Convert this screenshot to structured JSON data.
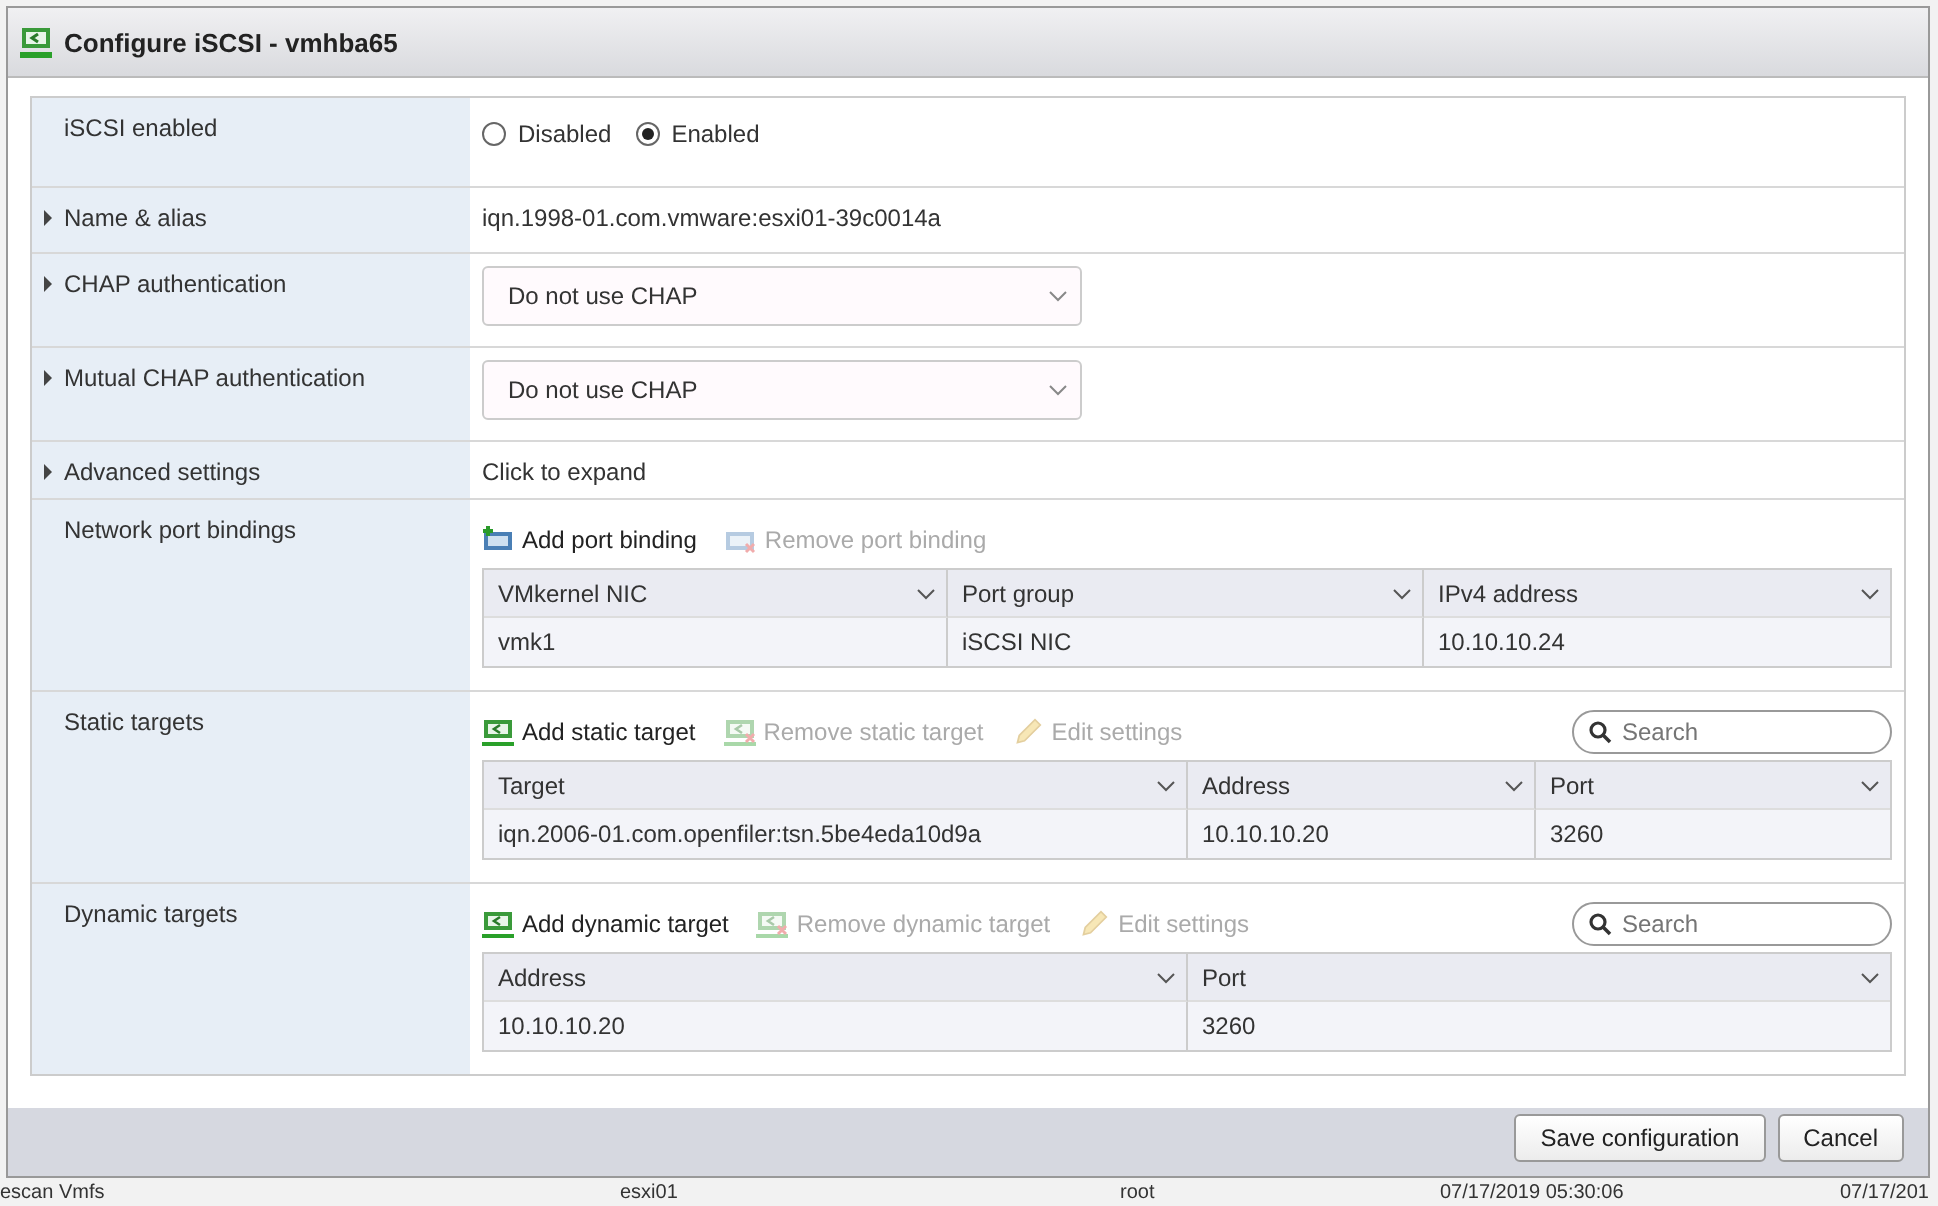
{
  "window": {
    "title": "Configure iSCSI - vmhba65"
  },
  "rows": [
    {
      "kind": "radio",
      "label": "iSCSI enabled",
      "options": [
        {
          "label": "Disabled",
          "selected": false
        },
        {
          "label": "Enabled",
          "selected": true
        }
      ]
    },
    {
      "kind": "text",
      "label": "Name & alias",
      "expanded": false,
      "value": "iqn.1998-01.com.vmware:esxi01-39c0014a"
    },
    {
      "kind": "select",
      "label": "CHAP authentication",
      "expanded": false,
      "value": "Do not use CHAP"
    },
    {
      "kind": "select",
      "label": "Mutual CHAP authentication",
      "expanded": false,
      "value": "Do not use CHAP"
    },
    {
      "kind": "text",
      "label": "Advanced settings",
      "expanded": false,
      "value": "Click to expand"
    },
    {
      "kind": "table",
      "label": "Network port bindings",
      "actions": [
        {
          "label": "Add port binding",
          "kind": "add",
          "disabled": false
        },
        {
          "label": "Remove port binding",
          "kind": "remove",
          "disabled": true
        }
      ],
      "columns": [
        "VMkernel NIC",
        "Port group",
        "IPv4 address"
      ],
      "rows": [
        [
          "vmk1",
          "iSCSI NIC",
          "10.10.10.24"
        ]
      ]
    },
    {
      "kind": "table",
      "label": "Static targets",
      "actions": [
        {
          "label": "Add static target",
          "kind": "add",
          "disabled": false
        },
        {
          "label": "Remove static target",
          "kind": "remove",
          "disabled": true
        },
        {
          "label": "Edit settings",
          "kind": "edit",
          "disabled": true
        }
      ],
      "search": {
        "placeholder": "Search"
      },
      "columns": [
        "Target",
        "Address",
        "Port"
      ],
      "rows": [
        [
          "iqn.2006-01.com.openfiler:tsn.5be4eda10d9a",
          "10.10.10.20",
          "3260"
        ]
      ]
    },
    {
      "kind": "table",
      "label": "Dynamic targets",
      "actions": [
        {
          "label": "Add dynamic target",
          "kind": "add",
          "disabled": false
        },
        {
          "label": "Remove dynamic target",
          "kind": "remove",
          "disabled": true
        },
        {
          "label": "Edit settings",
          "kind": "edit",
          "disabled": true
        }
      ],
      "search": {
        "placeholder": "Search"
      },
      "columns": [
        "Address",
        "Port"
      ],
      "rows": [
        [
          "10.10.10.20",
          "3260"
        ]
      ]
    }
  ],
  "buttons": [
    {
      "label": "Save configuration"
    },
    {
      "label": "Cancel"
    }
  ],
  "background_row": [
    "escan Vmfs",
    "esxi01",
    "root",
    "07/17/2019 05:30:06",
    "07/17/201"
  ]
}
